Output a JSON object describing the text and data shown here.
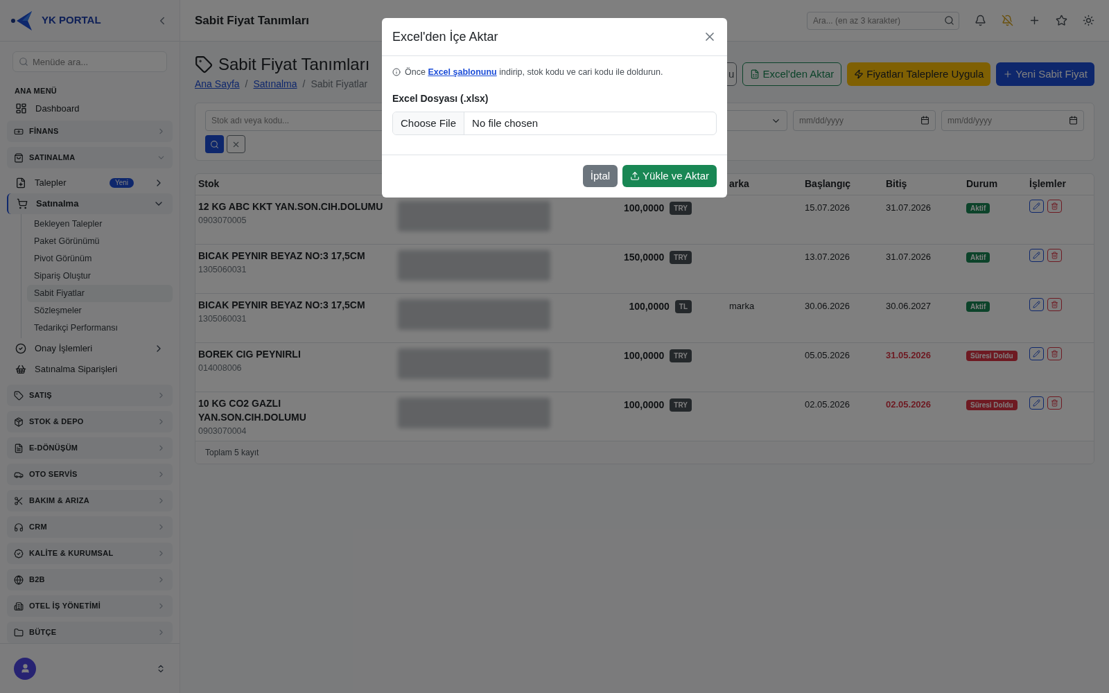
{
  "sidebar": {
    "logo": "YK PORTAL",
    "search": {
      "placeholder": "Menüde ara..."
    },
    "heading": "ANA MENÜ",
    "items": [
      {
        "kind": "link",
        "label": "Dashboard"
      },
      {
        "kind": "group",
        "label": "FİNANS",
        "expanded": false
      },
      {
        "kind": "group",
        "label": "SATINALMA",
        "expanded": true,
        "children": [
          {
            "label": "Talepler",
            "badge": "Yeni",
            "expanded": false,
            "selected": false
          },
          {
            "label": "Satınalma",
            "expanded": true,
            "selected": true,
            "children": [
              {
                "label": "Bekleyen Talepler",
                "selected": false
              },
              {
                "label": "Paket Görünümü",
                "selected": false
              },
              {
                "label": "Pivot Görünüm",
                "selected": false
              },
              {
                "label": "Sipariş Oluştur",
                "selected": false
              },
              {
                "label": "Sabit Fiyatlar",
                "selected": true
              },
              {
                "label": "Sözleşmeler",
                "selected": false
              },
              {
                "label": "Tedarikçi Performansı",
                "selected": false
              }
            ]
          },
          {
            "label": "Onay İşlemleri",
            "expanded": false,
            "selected": false
          },
          {
            "label": "Satınalma Siparişleri",
            "selected": false
          }
        ]
      },
      {
        "kind": "group",
        "label": "SATIŞ",
        "expanded": false
      },
      {
        "kind": "group",
        "label": "STOK & DEPO",
        "expanded": false
      },
      {
        "kind": "group",
        "label": "E-DÖNÜŞÜM",
        "expanded": false
      },
      {
        "kind": "group",
        "label": "OTO SERVİS",
        "expanded": false
      },
      {
        "kind": "group",
        "label": "BAKIM & ARIZA",
        "expanded": false
      },
      {
        "kind": "group",
        "label": "CRM",
        "expanded": false
      },
      {
        "kind": "group",
        "label": "KALİTE & KURUMSAL",
        "expanded": false
      },
      {
        "kind": "group",
        "label": "B2B",
        "expanded": false
      },
      {
        "kind": "group",
        "label": "OTEL İŞ YÖNETİMİ",
        "expanded": false
      },
      {
        "kind": "group",
        "label": "BÜTÇE",
        "expanded": false
      }
    ]
  },
  "header": {
    "title": "Sabit Fiyat Tanımları",
    "search": {
      "placeholder": "Ara... (en az 3 karakter)"
    }
  },
  "page": {
    "title": "Sabit Fiyat Tanımları",
    "breadcrumb": [
      {
        "kind": "link",
        "label": "Ana Sayfa"
      },
      {
        "kind": "separator",
        "label": "/"
      },
      {
        "kind": "link",
        "label": "Satınalma"
      },
      {
        "kind": "separator",
        "label": "/"
      },
      {
        "kind": "current",
        "label": "Sabit Fiyatlar"
      }
    ],
    "actions": [
      {
        "kind": "outline-dark",
        "label": "u"
      },
      {
        "kind": "outline-green",
        "label": "Excel'den Aktar"
      },
      {
        "kind": "warning",
        "label": "Fiyatları Taleplere Uygula"
      },
      {
        "kind": "primary",
        "label": "Yeni Sabit Fiyat"
      }
    ]
  },
  "filters": {
    "search": {
      "placeholder": "Stok adı veya kodu..."
    },
    "date_from": {
      "placeholder": "mm/dd/yyyy"
    },
    "date_to": {
      "placeholder": "mm/dd/yyyy"
    }
  },
  "table": {
    "columns": [
      "Stok",
      "arka",
      "Başlangıç",
      "Bitiş",
      "Durum",
      "İşlemler"
    ],
    "rows": [
      {
        "name": "12 KG ABC KKT YAN.SON.CIH.DOLUMU",
        "code": "0903070005",
        "price": "100,0000",
        "currency": "TRY",
        "brand": "",
        "start": "15.07.2026",
        "end": "31.07.2026",
        "expired": false,
        "status": {
          "kind": "active",
          "label": "Aktif"
        }
      },
      {
        "name": "BICAK PEYNIR BEYAZ NO:3 17,5CM",
        "code": "1305060031",
        "price": "150,0000",
        "currency": "TRY",
        "brand": "",
        "start": "13.07.2026",
        "end": "31.07.2026",
        "expired": false,
        "status": {
          "kind": "active",
          "label": "Aktif"
        }
      },
      {
        "name": "BICAK PEYNIR BEYAZ NO:3 17,5CM",
        "code": "1305060031",
        "price": "100,0000",
        "currency": "TL",
        "brand": "marka",
        "start": "30.06.2026",
        "end": "30.06.2027",
        "expired": false,
        "status": {
          "kind": "active",
          "label": "Aktif"
        }
      },
      {
        "name": "BOREK CIG PEYNIRLI",
        "code": "014008006",
        "price": "100,0000",
        "currency": "TRY",
        "brand": "",
        "start": "05.05.2026",
        "end": "31.05.2026",
        "expired": true,
        "status": {
          "kind": "expired",
          "label": "Süresi Doldu"
        }
      },
      {
        "name": "10 KG CO2 GAZLI YAN.SON.CIH.DOLUMU",
        "code": "0903070004",
        "price": "100,0000",
        "currency": "TRY",
        "brand": "",
        "start": "02.05.2026",
        "end": "02.05.2026",
        "expired": true,
        "status": {
          "kind": "expired",
          "label": "Süresi Doldu"
        }
      }
    ],
    "footer": "Toplam 5 kayıt"
  },
  "modal": {
    "title": "Excel'den İçe Aktar",
    "info_before": "Önce",
    "info_link": "Excel şablonunu",
    "info_after": "indirip, stok kodu ve cari kodu ile doldurun.",
    "file_label": "Excel Dosyası (.xlsx)",
    "file_button": "Choose File",
    "file_status": "No file chosen",
    "buttons": [
      {
        "kind": "secondary",
        "label": "İptal"
      },
      {
        "kind": "success",
        "label": "Yükle ve Aktar"
      }
    ]
  }
}
